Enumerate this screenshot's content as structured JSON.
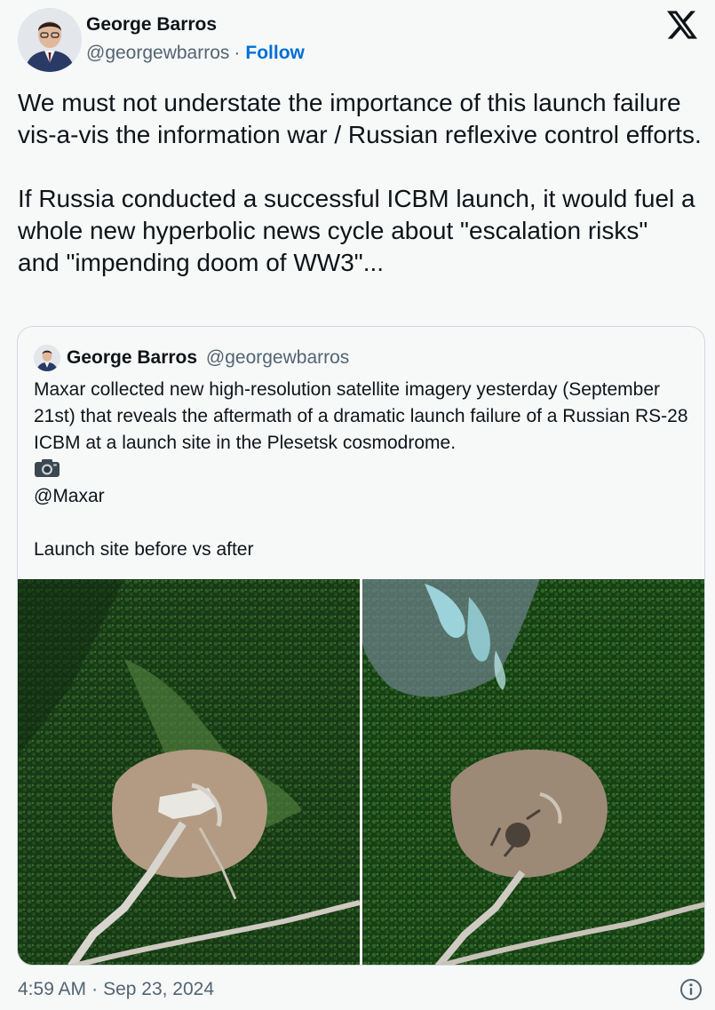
{
  "author": {
    "display_name": "George Barros",
    "handle": "@georgewbarros",
    "separator": "·",
    "follow_label": "Follow"
  },
  "brand": {
    "logo_icon": "x-logo-icon"
  },
  "tweet_text": "We must not understate the importance of this launch failure vis-a-vis the information war / Russian reflexive control efforts.\n\nIf Russia conducted a successful ICBM launch, it would fuel a whole new hyperbolic news cycle about \"escalation risks\"  and \"impending doom of WW3\"...",
  "quoted": {
    "display_name": "George Barros",
    "handle": "@georgewbarros",
    "text_main": "Maxar collected new high-resolution satellite imagery yesterday (September 21st) that reveals the aftermath of a dramatic launch failure of a Russian RS-28 ICBM at a launch site in the Plesetsk cosmodrome.",
    "camera_icon": "camera-icon",
    "text_credit": "@Maxar",
    "text_caption": "Launch site before vs after",
    "images": [
      {
        "icon": "satellite-image-before"
      },
      {
        "icon": "satellite-image-after"
      }
    ]
  },
  "footer": {
    "time": "4:59 AM",
    "separator": "·",
    "date": "Sep 23, 2024",
    "info_icon": "info-icon"
  },
  "colors": {
    "background": "#f7f9f9",
    "text": "#0f1419",
    "secondary": "#536471",
    "link": "#006fd6",
    "border": "#cfd9de"
  }
}
